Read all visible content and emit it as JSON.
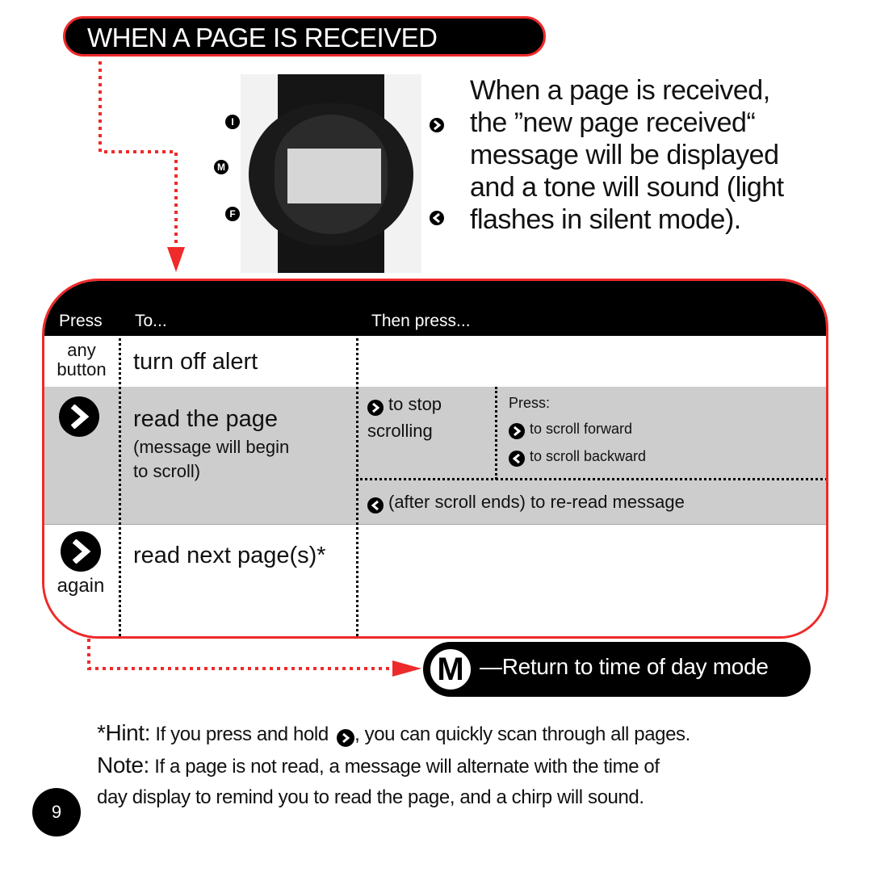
{
  "header": {
    "title": "WHEN A PAGE IS RECEIVED"
  },
  "watch": {
    "left_buttons": [
      "I",
      "M",
      "F"
    ],
    "right_buttons": [
      "forward-arrow",
      "back-arrow"
    ]
  },
  "description": {
    "lines": [
      "When a page is received,",
      "the ”new page received“",
      "message will be displayed",
      "and a tone will sound (light",
      "flashes in silent mode)."
    ]
  },
  "table": {
    "headers": {
      "press": "Press",
      "to": "To...",
      "then": "Then press..."
    },
    "rows": [
      {
        "press": "any button",
        "press_line1": "any",
        "press_line2": "button",
        "to": "turn off alert"
      },
      {
        "press_icon": "forward-arrow",
        "to": "read the page",
        "to_sub_line1": "(message will begin",
        "to_sub_line2": "to scroll)",
        "then_stop_line1": "to stop",
        "then_stop_line2": "scrolling",
        "then_press_label": "Press:",
        "then_forward": "to scroll forward",
        "then_backward": "to scroll backward",
        "then_reread": "(after scroll ends) to re-read message"
      },
      {
        "press_icon": "forward-arrow",
        "press_suffix": "again",
        "to": "read next page(s)*"
      }
    ]
  },
  "return_mode": {
    "button": "M",
    "label": "—Return to time of day mode"
  },
  "notes": {
    "hint_lead": "*Hint:",
    "hint_before": "If you press and hold",
    "hint_after": ", you can quickly scan through all pages.",
    "note_lead": "Note:",
    "note_line1": "If a page is not read, a message will alternate with the time of",
    "note_line2": "day display to remind you to read the page, and a chirp will sound."
  },
  "page_number": "9",
  "colors": {
    "accent_red": "#ef2a2a",
    "row_gray": "#cdcdcd",
    "black": "#000000"
  }
}
